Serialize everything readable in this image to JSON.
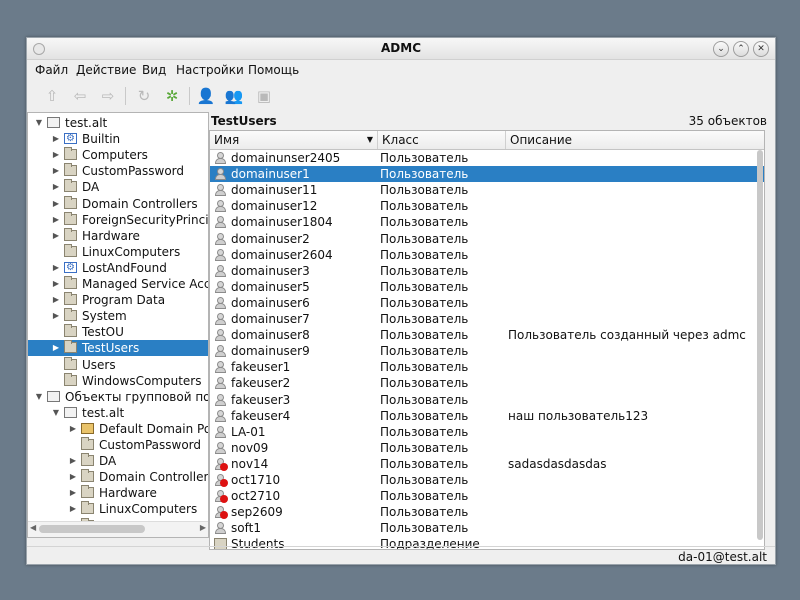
{
  "window": {
    "title": "ADMC"
  },
  "menu": [
    "Файл",
    "Действие",
    "Вид",
    "Настройки",
    "Помощь"
  ],
  "toolbar": {
    "icons": [
      "up-arrow-icon",
      "back-arrow-icon",
      "forward-arrow-icon",
      "refresh-icon",
      "connect-icon",
      "user-icon",
      "group-icon",
      "ou-icon"
    ]
  },
  "tree": {
    "items": [
      {
        "label": "test.alt",
        "expanded": true,
        "icon": "server-icon"
      },
      {
        "label": "Builtin",
        "icon": "builtin-icon"
      },
      {
        "label": "Computers",
        "icon": "folder-icon"
      },
      {
        "label": "CustomPassword",
        "icon": "ou-icon"
      },
      {
        "label": "DA",
        "icon": "ou-icon"
      },
      {
        "label": "Domain Controllers",
        "icon": "ou-icon"
      },
      {
        "label": "ForeignSecurityPrincipals",
        "icon": "folder-icon"
      },
      {
        "label": "Hardware",
        "icon": "ou-icon"
      },
      {
        "label": "LinuxComputers",
        "icon": "ou-icon"
      },
      {
        "label": "LostAndFound",
        "icon": "builtin-icon"
      },
      {
        "label": "Managed Service Accounts",
        "icon": "folder-icon"
      },
      {
        "label": "Program Data",
        "icon": "folder-icon"
      },
      {
        "label": "System",
        "icon": "folder-icon"
      },
      {
        "label": "TestOU",
        "icon": "ou-icon"
      },
      {
        "label": "TestUsers",
        "icon": "ou-icon",
        "selected": true
      },
      {
        "label": "Users",
        "icon": "folder-icon"
      },
      {
        "label": "WindowsComputers",
        "icon": "ou-icon"
      },
      {
        "label": "Объекты групповой политики",
        "expanded": true,
        "icon": "server-icon"
      },
      {
        "label": "test.alt",
        "expanded": true,
        "icon": "server-icon"
      },
      {
        "label": "Default Domain Policy",
        "icon": "gpo-icon"
      },
      {
        "label": "CustomPassword",
        "icon": "ou-icon"
      },
      {
        "label": "DA",
        "icon": "ou-icon"
      },
      {
        "label": "Domain Controllers",
        "icon": "ou-icon"
      },
      {
        "label": "Hardware",
        "icon": "ou-icon"
      },
      {
        "label": "LinuxComputers",
        "icon": "ou-icon"
      },
      {
        "label": "TestOU",
        "icon": "ou-icon"
      }
    ]
  },
  "content": {
    "title": "TestUsers",
    "count": "35 объектов",
    "columns": {
      "name": "Имя",
      "class": "Класс",
      "description": "Описание"
    },
    "rows": [
      {
        "name": "domainunser2405",
        "class": "Пользователь",
        "description": "",
        "icon": "user-icon"
      },
      {
        "name": "domainuser1",
        "class": "Пользователь",
        "description": "",
        "icon": "user-icon",
        "selected": true
      },
      {
        "name": "domainuser11",
        "class": "Пользователь",
        "description": "",
        "icon": "user-icon"
      },
      {
        "name": "domainuser12",
        "class": "Пользователь",
        "description": "",
        "icon": "user-icon"
      },
      {
        "name": "domainuser1804",
        "class": "Пользователь",
        "description": "",
        "icon": "user-icon"
      },
      {
        "name": "domainuser2",
        "class": "Пользователь",
        "description": "",
        "icon": "user-icon"
      },
      {
        "name": "domainuser2604",
        "class": "Пользователь",
        "description": "",
        "icon": "user-icon"
      },
      {
        "name": "domainuser3",
        "class": "Пользователь",
        "description": "",
        "icon": "user-icon"
      },
      {
        "name": "domainuser5",
        "class": "Пользователь",
        "description": "",
        "icon": "user-icon"
      },
      {
        "name": "domainuser6",
        "class": "Пользователь",
        "description": "",
        "icon": "user-icon"
      },
      {
        "name": "domainuser7",
        "class": "Пользователь",
        "description": "",
        "icon": "user-icon"
      },
      {
        "name": "domainuser8",
        "class": "Пользователь",
        "description": "Пользователь созданный через admc",
        "icon": "user-icon"
      },
      {
        "name": "domainuser9",
        "class": "Пользователь",
        "description": "",
        "icon": "user-icon"
      },
      {
        "name": "fakeuser1",
        "class": "Пользователь",
        "description": "",
        "icon": "user-icon"
      },
      {
        "name": "fakeuser2",
        "class": "Пользователь",
        "description": "",
        "icon": "user-icon"
      },
      {
        "name": "fakeuser3",
        "class": "Пользователь",
        "description": "",
        "icon": "user-icon"
      },
      {
        "name": "fakeuser4",
        "class": "Пользователь",
        "description": "наш пользователь123",
        "icon": "user-icon"
      },
      {
        "name": "LA-01",
        "class": "Пользователь",
        "description": "",
        "icon": "user-icon"
      },
      {
        "name": "nov09",
        "class": "Пользователь",
        "description": "",
        "icon": "user-icon"
      },
      {
        "name": "nov14",
        "class": "Пользователь",
        "description": "sadasdasdasdas",
        "icon": "disabled-user-icon"
      },
      {
        "name": "oct1710",
        "class": "Пользователь",
        "description": "",
        "icon": "disabled-user-icon"
      },
      {
        "name": "oct2710",
        "class": "Пользователь",
        "description": "",
        "icon": "disabled-user-icon"
      },
      {
        "name": "sep2609",
        "class": "Пользователь",
        "description": "",
        "icon": "disabled-user-icon"
      },
      {
        "name": "soft1",
        "class": "Пользователь",
        "description": "",
        "icon": "user-icon"
      },
      {
        "name": "Students",
        "class": "Подразделение",
        "description": "",
        "icon": "ou-icon"
      }
    ]
  },
  "status": {
    "text": "da-01@test.alt"
  },
  "colors": {
    "selection": "#2a7fc4",
    "window_bg": "#efefef",
    "desktop": "#6b7b8a"
  }
}
